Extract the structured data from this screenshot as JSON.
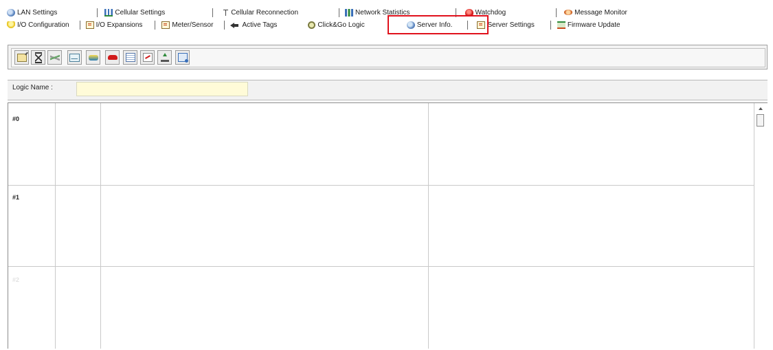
{
  "tabs_row1": [
    {
      "label": "LAN Settings",
      "icon": "lan-icon"
    },
    {
      "label": "Cellular Settings",
      "icon": "cellular-signal-icon"
    },
    {
      "label": "Cellular Reconnection",
      "icon": "antenna-icon"
    },
    {
      "label": "Network Statistics",
      "icon": "network-bars-icon"
    },
    {
      "label": "Watchdog",
      "icon": "watchdog-icon"
    },
    {
      "label": "Message Monitor",
      "icon": "message-icon"
    }
  ],
  "tabs_row2": [
    {
      "label": "I/O Configuration",
      "icon": "bulb-icon"
    },
    {
      "label": "I/O Expansions",
      "icon": "expansion-icon"
    },
    {
      "label": "Meter/Sensor",
      "icon": "meter-icon"
    },
    {
      "label": "Active Tags",
      "icon": "tag-arrow-icon"
    },
    {
      "label": "Click&Go Logic",
      "icon": "logic-icon",
      "selected": true
    },
    {
      "label": "Server Info.",
      "icon": "server-icon"
    },
    {
      "label": "Server Settings",
      "icon": "settings-icon"
    },
    {
      "label": "Firmware Update",
      "icon": "firmware-icon"
    }
  ],
  "highlight_color": "#e0101b",
  "toolbar": {
    "buttons": [
      {
        "name": "edit-logic-button",
        "icon": "edit-icon"
      },
      {
        "name": "timer-button",
        "icon": "hourglass-icon"
      },
      {
        "name": "snmp-trap-button",
        "icon": "snmp-icon"
      },
      {
        "name": "email-button",
        "icon": "mail-icon"
      },
      {
        "name": "modem-button",
        "icon": "modem-icon"
      },
      {
        "name": "phone-button",
        "icon": "phone-icon"
      },
      {
        "name": "table-button",
        "icon": "table-icon"
      },
      {
        "name": "chart-button",
        "icon": "chart-icon"
      },
      {
        "name": "upload-button",
        "icon": "upload-icon"
      },
      {
        "name": "config-button",
        "icon": "config-icon"
      }
    ]
  },
  "logic_name": {
    "label": "Logic Name :",
    "value": ""
  },
  "rows": [
    {
      "label": "#0"
    },
    {
      "label": "#1"
    },
    {
      "label": "#2"
    }
  ]
}
